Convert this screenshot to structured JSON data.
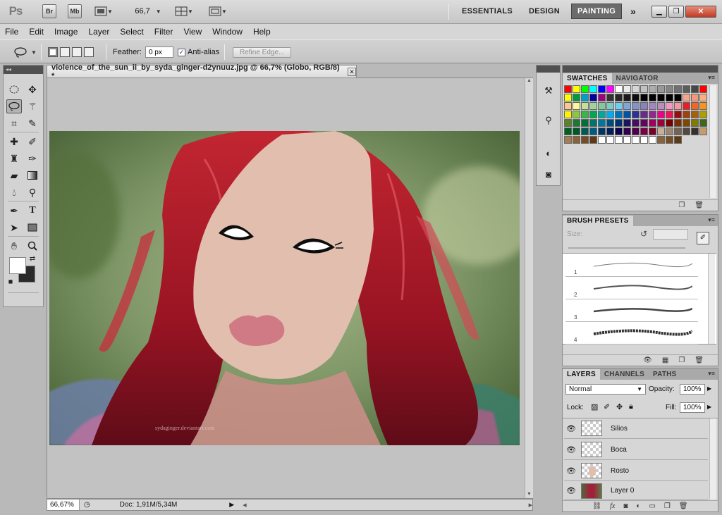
{
  "app": {
    "logo": "Ps",
    "bridge_label": "Br",
    "minibridge_label": "Mb",
    "zoom_value": "66,7",
    "workspaces": [
      "ESSENTIALS",
      "DESIGN",
      "PAINTING"
    ],
    "active_workspace": "PAINTING",
    "more_label": "»"
  },
  "menu": [
    "File",
    "Edit",
    "Image",
    "Layer",
    "Select",
    "Filter",
    "View",
    "Window",
    "Help"
  ],
  "options": {
    "feather_label": "Feather:",
    "feather_value": "0 px",
    "antialias_label": "Anti-alias",
    "refine_label": "Refine Edge..."
  },
  "document": {
    "tab_title": "violence_of_the_sun_ii_by_syda_ginger-d2ynuuz.jpg @ 66,7% (Globo, RGB/8) *",
    "watermark": "sydaginger.deviantart.com",
    "status_zoom": "66,67%",
    "status_doc": "Doc: 1,91M/5,34M"
  },
  "swatches": {
    "tabs": [
      "SWATCHES",
      "NAVIGATOR"
    ],
    "colors": [
      "#ff0000",
      "#ffff00",
      "#00ff00",
      "#00ffff",
      "#0000ff",
      "#ff00ff",
      "#ffffff",
      "#ebebeb",
      "#d6d6d6",
      "#c2c2c2",
      "#adadad",
      "#999999",
      "#858585",
      "#707070",
      "#5c5c5c",
      "#474747",
      "#ff0000",
      "#ffff00",
      "#009c3b",
      "#00a0c6",
      "#0000a0",
      "#a00080",
      "#333333",
      "#262626",
      "#1a1a1a",
      "#0d0d0d",
      "#000000",
      "#000000",
      "#000000",
      "#000000",
      "#000000",
      "#f4a58a",
      "#f7977a",
      "#f9ad81",
      "#fdc68a",
      "#fff79a",
      "#c4df9b",
      "#a2d39c",
      "#82ca9d",
      "#7bcdc8",
      "#6ecff6",
      "#7ea7d8",
      "#8493ca",
      "#8882be",
      "#a187be",
      "#bc8dbf",
      "#f49ac2",
      "#f6989d",
      "#ed1c24",
      "#f26522",
      "#f7941d",
      "#fff200",
      "#8dc63f",
      "#39b54a",
      "#00a651",
      "#00a99d",
      "#00aeef",
      "#0072bc",
      "#0054a6",
      "#2e3192",
      "#662d91",
      "#92278f",
      "#ec008c",
      "#ed145b",
      "#9e0b0f",
      "#a0410d",
      "#a36209",
      "#aba000",
      "#598527",
      "#1a7b30",
      "#007236",
      "#00746b",
      "#0076a3",
      "#004b80",
      "#003471",
      "#1b1464",
      "#440e62",
      "#630460",
      "#9e005d",
      "#9e0039",
      "#790000",
      "#7b2e00",
      "#7d4900",
      "#827b00",
      "#406618",
      "#005e20",
      "#005826",
      "#005952",
      "#005b7f",
      "#003663",
      "#002157",
      "#0d004c",
      "#32004b",
      "#4b0049",
      "#7b0046",
      "#7a0026",
      "#c7b299",
      "#998675",
      "#736357",
      "#534741",
      "#37302d",
      "#c69c6d",
      "#a67c52",
      "#8c6239",
      "#754c24",
      "#603913",
      "#ffffff",
      "#ffffff",
      "#ffffff",
      "#ffffff",
      "#ffffff",
      "#ffffff",
      "#ffffff",
      "#8c6239",
      "#754c24",
      "#603913"
    ]
  },
  "brushes": {
    "tab": "BRUSH PRESETS",
    "size_label": "Size:",
    "items": [
      "1",
      "2",
      "3",
      "4"
    ]
  },
  "layers": {
    "tabs": [
      "LAYERS",
      "CHANNELS",
      "PATHS"
    ],
    "blend_mode": "Normal",
    "opacity_label": "Opacity:",
    "opacity_value": "100%",
    "lock_label": "Lock:",
    "fill_label": "Fill:",
    "fill_value": "100%",
    "items": [
      "Silios",
      "Boca",
      "Rosto",
      "Layer 0"
    ]
  }
}
